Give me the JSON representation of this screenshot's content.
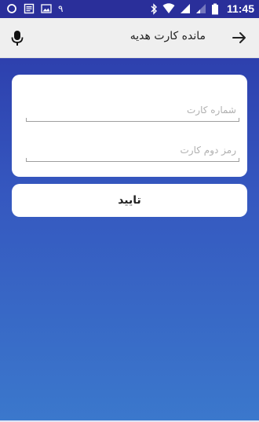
{
  "status_bar": {
    "time": "11:45",
    "notification_digit": "۹",
    "icons": [
      "circle-sync-icon",
      "news-icon",
      "image-icon",
      "bluetooth-icon",
      "wifi-icon",
      "signal-icon",
      "signal-empty-icon",
      "battery-icon"
    ]
  },
  "app_bar": {
    "title": "مانده کارت هدیه",
    "back_icon": "arrow-right-icon",
    "mic_icon": "microphone-icon"
  },
  "form": {
    "card_number_placeholder": "شماره کارت",
    "second_password_placeholder": "رمز دوم کارت",
    "card_number_value": "",
    "second_password_value": ""
  },
  "actions": {
    "confirm_label": "تایید"
  },
  "colors": {
    "status_bar": "#2a2f9a",
    "gradient_top": "#2a36a6",
    "gradient_bottom": "#3b78cc",
    "app_bar": "#efefef"
  }
}
